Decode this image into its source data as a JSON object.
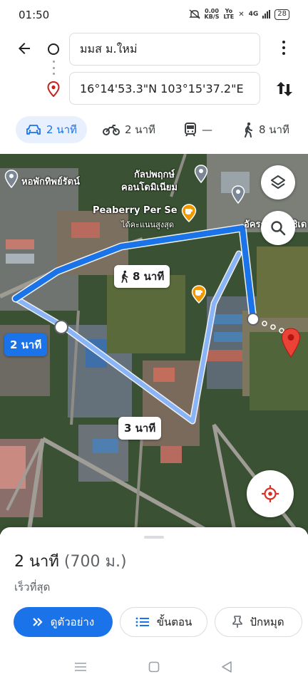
{
  "status_bar": {
    "time": "01:50",
    "net_speed_value": "0.00",
    "net_speed_unit": "KB/S",
    "volte_top": "Yo",
    "volte_bottom": "LTE",
    "network": "4G",
    "battery": "28"
  },
  "directions": {
    "origin": "มมส ม.ใหม่",
    "destination": "16°14'53.3\"N 103°15'37.2\"E"
  },
  "modes": [
    {
      "icon": "car-icon",
      "label": "2 นาที",
      "active": true
    },
    {
      "icon": "motorcycle-icon",
      "label": "2 นาที",
      "active": false
    },
    {
      "icon": "transit-icon",
      "label": "—",
      "active": false
    },
    {
      "icon": "walk-icon",
      "label": "8 นาที",
      "active": false
    }
  ],
  "map": {
    "labels": {
      "dorm": "หอพักทิพย์รัตน์",
      "condo_line1": "กัลปพฤกษ์",
      "condo_line2": "คอนโดมิเนียม",
      "cafe": "Peaberry Per Se",
      "cafe_sub": "ได้คะแนนสูงสุด",
      "place_right": "อัครณัฐ เรสซิเด"
    },
    "route_badges": {
      "walk": "8 นาที",
      "primary": "2 นาที",
      "alt": "3 นาที"
    },
    "colors": {
      "primary_route": "#1a73e8",
      "alt_route": "#8ab4f8",
      "destination_pin": "#ea4335"
    }
  },
  "sheet": {
    "duration": "2 นาที",
    "distance": "(700 ม.)",
    "note": "เร็วที่สุด",
    "buttons": {
      "preview": "ดูตัวอย่าง",
      "steps": "ขั้นตอน",
      "pin": "ปักหมุด"
    }
  }
}
